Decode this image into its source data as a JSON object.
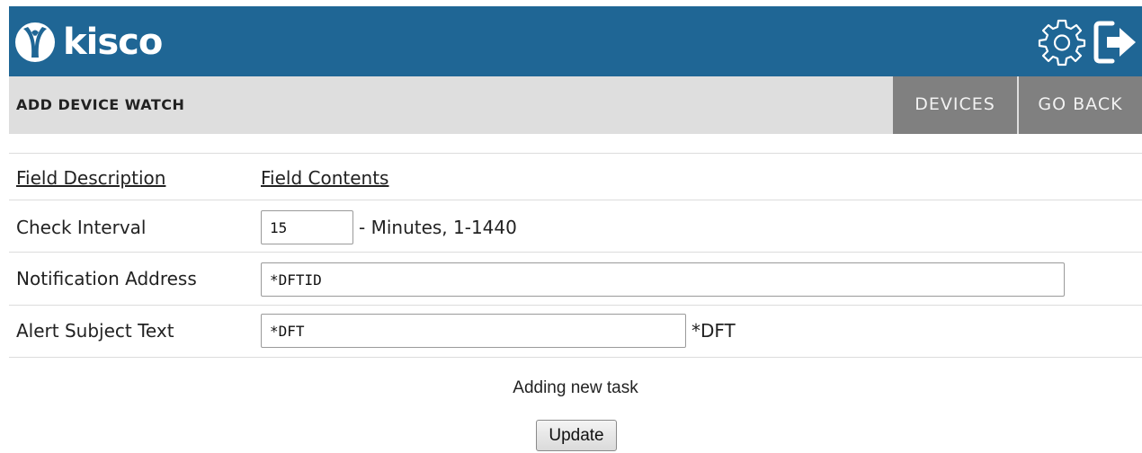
{
  "app": {
    "brand": "kisco",
    "colors": {
      "header": "#1f6695",
      "titlebar": "#dedede",
      "nav": "#808080"
    }
  },
  "header": {
    "icons": [
      "settings-gear-icon",
      "logout-icon"
    ]
  },
  "titlebar": {
    "title": "ADD DEVICE WATCH",
    "nav": {
      "devices": "DEVICES",
      "go_back": "GO BACK"
    }
  },
  "form": {
    "headers": {
      "description": "Field Description",
      "contents": "Field Contents"
    },
    "check_interval": {
      "label": "Check Interval",
      "value": "15",
      "suffix": "- Minutes, 1-1440"
    },
    "notification_address": {
      "label": "Notification Address",
      "value": "*DFTID"
    },
    "alert_subject": {
      "label": "Alert Subject Text",
      "value": "*DFT",
      "suffix": "*DFT"
    }
  },
  "status": "Adding new task",
  "update_label": "Update"
}
